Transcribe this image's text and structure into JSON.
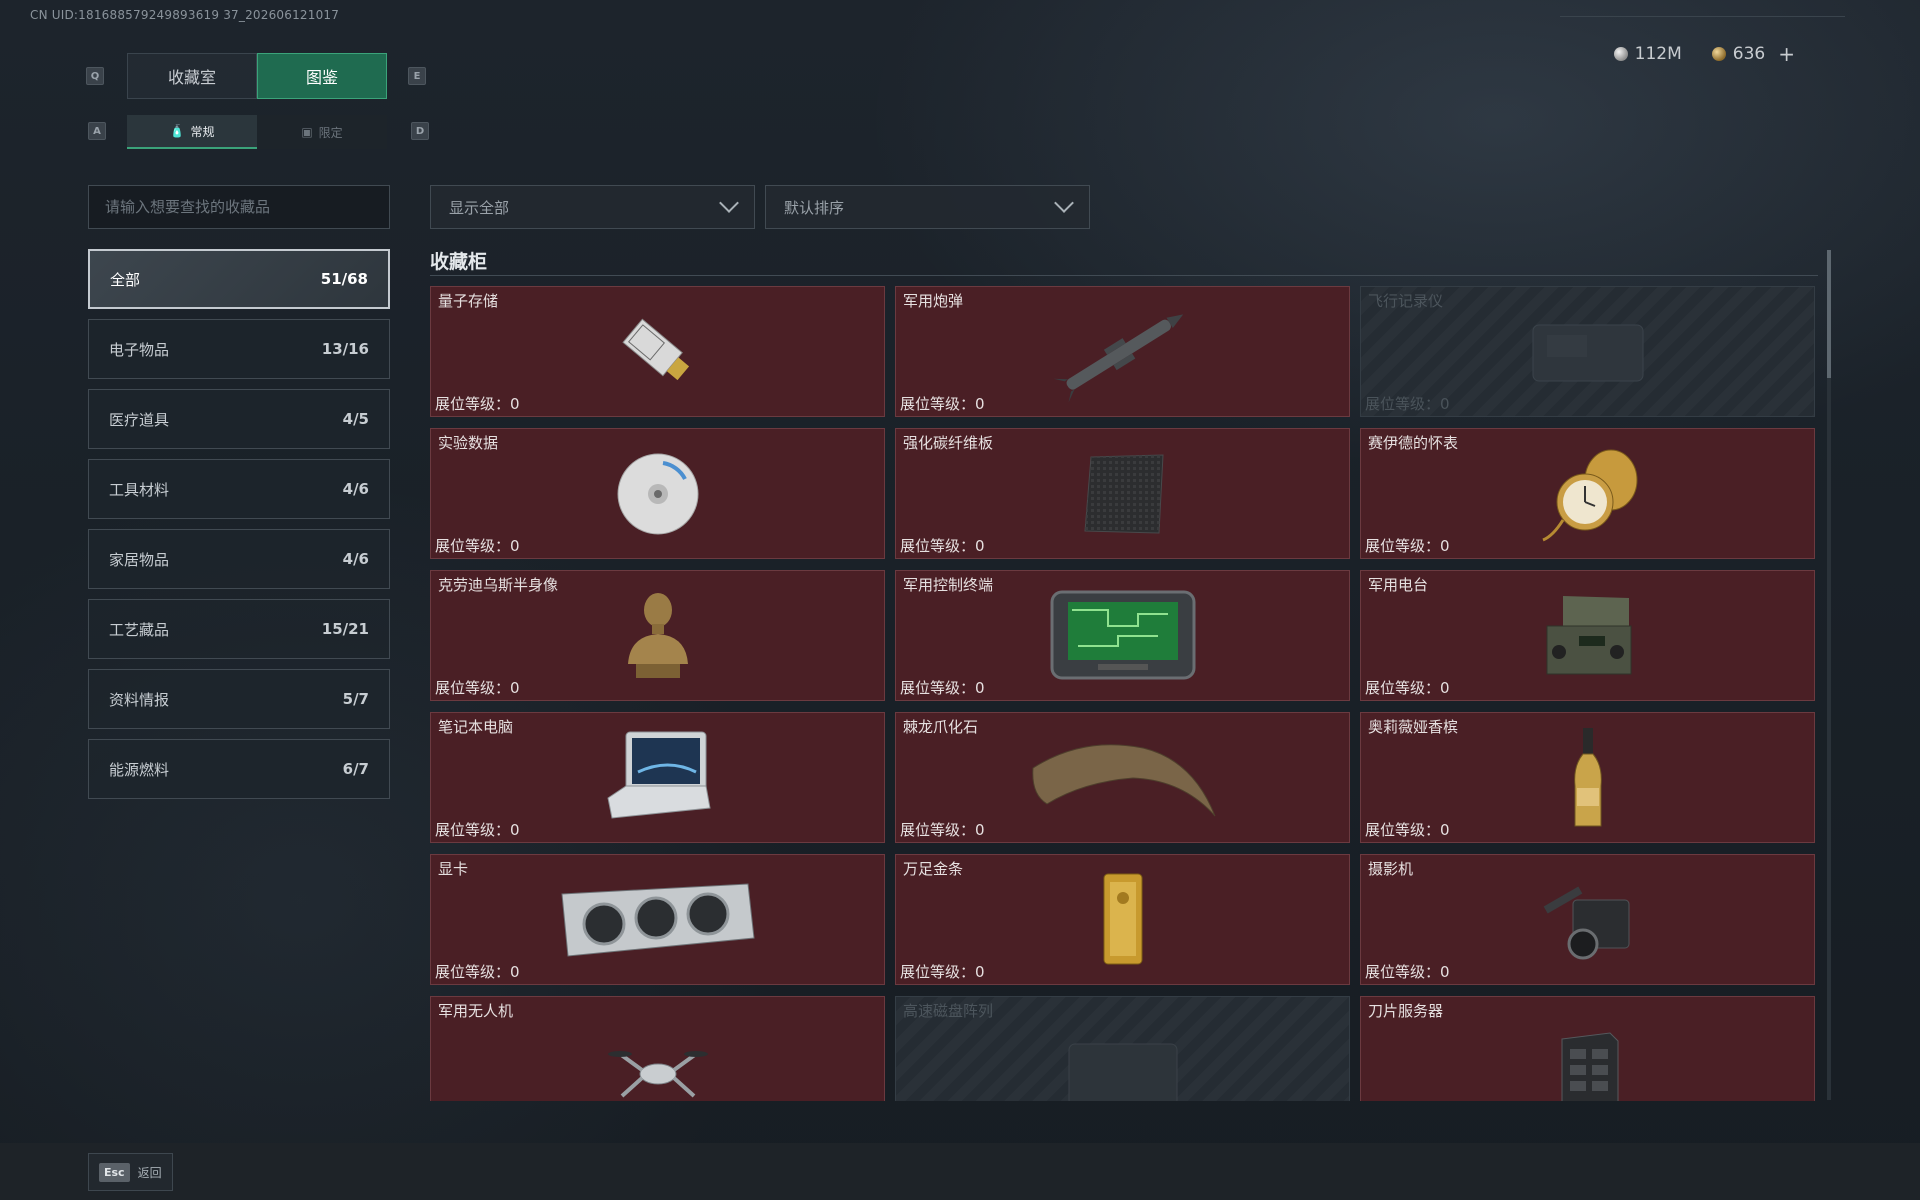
{
  "uid_text": "CN UID:181688579249893619 37_202606121017",
  "currency": {
    "silver": "112M",
    "gold": "636",
    "plus": "+"
  },
  "keys": {
    "q": "Q",
    "e": "E",
    "a": "A",
    "d": "D"
  },
  "main_tabs": [
    {
      "label": "收藏室",
      "active": false
    },
    {
      "label": "图鉴",
      "active": true
    }
  ],
  "sub_tabs": [
    {
      "label": "常规",
      "icon": "bottle-icon",
      "active": true
    },
    {
      "label": "限定",
      "icon": "image-icon",
      "active": false
    }
  ],
  "search": {
    "placeholder": "请输入想要查找的收藏品",
    "value": ""
  },
  "filters": {
    "show": "显示全部",
    "sort": "默认排序"
  },
  "categories": [
    {
      "label": "全部",
      "count": "51/68",
      "active": true
    },
    {
      "label": "电子物品",
      "count": "13/16"
    },
    {
      "label": "医疗道具",
      "count": "4/5"
    },
    {
      "label": "工具材料",
      "count": "4/6"
    },
    {
      "label": "家居物品",
      "count": "4/6"
    },
    {
      "label": "工艺藏品",
      "count": "15/21"
    },
    {
      "label": "资料情报",
      "count": "5/7"
    },
    {
      "label": "能源燃料",
      "count": "6/7"
    }
  ],
  "section_title": "收藏柜",
  "items": [
    {
      "name": "量子存储",
      "level": "展位等级：0",
      "locked": false,
      "icon": "usb-drive-icon"
    },
    {
      "name": "军用炮弹",
      "level": "展位等级：0",
      "locked": false,
      "icon": "missile-icon"
    },
    {
      "name": "飞行记录仪",
      "level": "展位等级：0",
      "locked": true,
      "icon": "flight-recorder-icon"
    },
    {
      "name": "实验数据",
      "level": "展位等级：0",
      "locked": false,
      "icon": "disc-icon"
    },
    {
      "name": "强化碳纤维板",
      "level": "展位等级：0",
      "locked": false,
      "icon": "carbon-plate-icon"
    },
    {
      "name": "赛伊德的怀表",
      "level": "展位等级：0",
      "locked": false,
      "icon": "pocket-watch-icon"
    },
    {
      "name": "克劳迪乌斯半身像",
      "level": "展位等级：0",
      "locked": false,
      "icon": "bust-icon"
    },
    {
      "name": "军用控制终端",
      "level": "展位等级：0",
      "locked": false,
      "icon": "control-terminal-icon"
    },
    {
      "name": "军用电台",
      "level": "展位等级：0",
      "locked": false,
      "icon": "radio-icon"
    },
    {
      "name": "笔记本电脑",
      "level": "展位等级：0",
      "locked": false,
      "icon": "laptop-icon"
    },
    {
      "name": "棘龙爪化石",
      "level": "展位等级：0",
      "locked": false,
      "icon": "claw-fossil-icon"
    },
    {
      "name": "奥莉薇娅香槟",
      "level": "展位等级：0",
      "locked": false,
      "icon": "champagne-icon"
    },
    {
      "name": "显卡",
      "level": "展位等级：0",
      "locked": false,
      "icon": "graphics-card-icon"
    },
    {
      "name": "万足金条",
      "level": "展位等级：0",
      "locked": false,
      "icon": "gold-bar-icon"
    },
    {
      "name": "摄影机",
      "level": "展位等级：0",
      "locked": false,
      "icon": "camera-icon"
    },
    {
      "name": "军用无人机",
      "level": "",
      "locked": false,
      "icon": "drone-icon"
    },
    {
      "name": "高速磁盘阵列",
      "level": "",
      "locked": true,
      "icon": "disk-array-icon"
    },
    {
      "name": "刀片服务器",
      "level": "",
      "locked": false,
      "icon": "blade-server-icon"
    }
  ],
  "footer": {
    "key": "Esc",
    "label": "返回"
  }
}
